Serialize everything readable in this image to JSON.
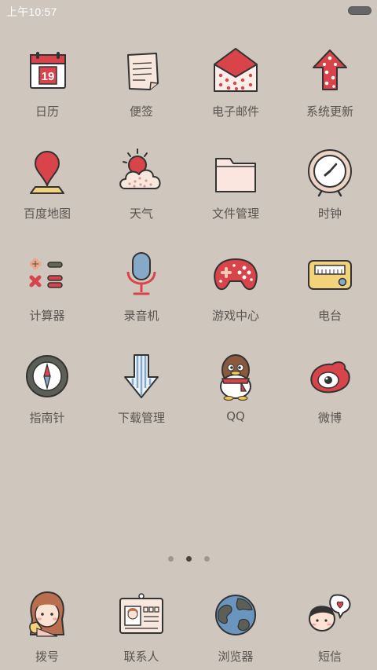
{
  "status": {
    "time": "上午10:57"
  },
  "apps": [
    {
      "label": "日历",
      "icon": "calendar-icon"
    },
    {
      "label": "便签",
      "icon": "notes-icon"
    },
    {
      "label": "电子邮件",
      "icon": "email-icon"
    },
    {
      "label": "系统更新",
      "icon": "update-icon"
    },
    {
      "label": "百度地图",
      "icon": "map-icon"
    },
    {
      "label": "天气",
      "icon": "weather-icon"
    },
    {
      "label": "文件管理",
      "icon": "folder-icon"
    },
    {
      "label": "时钟",
      "icon": "clock-icon"
    },
    {
      "label": "计算器",
      "icon": "calculator-icon"
    },
    {
      "label": "录音机",
      "icon": "microphone-icon"
    },
    {
      "label": "游戏中心",
      "icon": "gamepad-icon"
    },
    {
      "label": "电台",
      "icon": "radio-icon"
    },
    {
      "label": "指南针",
      "icon": "compass-icon"
    },
    {
      "label": "下载管理",
      "icon": "download-icon"
    },
    {
      "label": "QQ",
      "icon": "qq-penguin-icon"
    },
    {
      "label": "微博",
      "icon": "weibo-icon"
    }
  ],
  "calendar": {
    "day": "19"
  },
  "pager": {
    "count": 3,
    "active_index": 1
  },
  "dock": [
    {
      "label": "拨号",
      "icon": "phone-girl-icon"
    },
    {
      "label": "联系人",
      "icon": "contacts-card-icon"
    },
    {
      "label": "浏览器",
      "icon": "globe-icon"
    },
    {
      "label": "短信",
      "icon": "message-heart-icon"
    }
  ],
  "colors": {
    "background": "#cfc6bd",
    "accent_red": "#d9434a",
    "label": "#5a5450"
  }
}
